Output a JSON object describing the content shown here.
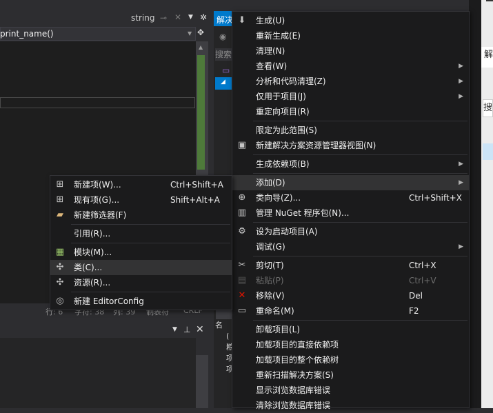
{
  "editor": {
    "search_term": "string",
    "nav_function": "print_name()",
    "status": {
      "line": "行: 6",
      "char": "字符: 38",
      "col": "列: 39",
      "indent": "制表符",
      "eol": "CRLF"
    }
  },
  "solution_explorer": {
    "tab_label": "解决方案资源管理器",
    "search_placeholder": "搜索解决方案资源管理器",
    "bottom_items": [
      "名",
      "(",
      "粮",
      "项",
      "项"
    ]
  },
  "right_window": {
    "title": "解",
    "search": "搜"
  },
  "context_menu": {
    "items": [
      {
        "label": "生成(U)",
        "icon": "build-icon"
      },
      {
        "label": "重新生成(E)"
      },
      {
        "label": "清理(N)"
      },
      {
        "label": "查看(W)",
        "submenu": true
      },
      {
        "label": "分析和代码清理(Z)",
        "submenu": true
      },
      {
        "label": "仅用于项目(J)",
        "submenu": true
      },
      {
        "label": "重定向项目(R)"
      },
      {
        "separator": true
      },
      {
        "label": "限定为此范围(S)"
      },
      {
        "label": "新建解决方案资源管理器视图(N)",
        "icon": "new-view-icon"
      },
      {
        "separator": true
      },
      {
        "label": "生成依赖项(B)",
        "submenu": true
      },
      {
        "separator": true
      },
      {
        "label": "添加(D)",
        "submenu": true,
        "highlighted": true
      },
      {
        "label": "类向导(Z)...",
        "shortcut": "Ctrl+Shift+X",
        "icon": "class-wizard-icon"
      },
      {
        "label": "管理 NuGet 程序包(N)...",
        "icon": "nuget-icon"
      },
      {
        "separator": true
      },
      {
        "label": "设为启动项目(A)",
        "icon": "gear-icon"
      },
      {
        "label": "调试(G)",
        "submenu": true
      },
      {
        "separator": true
      },
      {
        "label": "剪切(T)",
        "shortcut": "Ctrl+X",
        "icon": "scissors-icon"
      },
      {
        "label": "粘贴(P)",
        "shortcut": "Ctrl+V",
        "icon": "paste-icon",
        "disabled": true
      },
      {
        "label": "移除(V)",
        "shortcut": "Del",
        "icon": "remove-icon"
      },
      {
        "label": "重命名(M)",
        "shortcut": "F2",
        "icon": "rename-icon"
      },
      {
        "separator": true
      },
      {
        "label": "卸载项目(L)"
      },
      {
        "label": "加载项目的直接依赖项"
      },
      {
        "label": "加载项目的整个依赖树"
      },
      {
        "label": "重新扫描解决方案(S)"
      },
      {
        "label": "显示浏览数据库错误"
      },
      {
        "label": "清除浏览数据库错误"
      }
    ]
  },
  "add_submenu": {
    "items": [
      {
        "label": "新建项(W)...",
        "shortcut": "Ctrl+Shift+A",
        "icon": "new-item-icon"
      },
      {
        "label": "现有项(G)...",
        "shortcut": "Shift+Alt+A",
        "icon": "existing-item-icon"
      },
      {
        "label": "新建筛选器(F)",
        "icon": "new-filter-icon"
      },
      {
        "separator": true
      },
      {
        "label": "引用(R)..."
      },
      {
        "separator": true
      },
      {
        "label": "模块(M)...",
        "icon": "module-icon"
      },
      {
        "label": "类(C)...",
        "icon": "class-icon",
        "highlighted": true
      },
      {
        "label": "资源(R)...",
        "icon": "resource-icon"
      },
      {
        "separator": true
      },
      {
        "label": "新建 EditorConfig",
        "icon": "lightbulb-icon"
      }
    ]
  },
  "colors": {
    "accent": "#007acc",
    "menu_bg": "#1b1b1c",
    "highlight": "#333334",
    "remove_red": "#e51400"
  }
}
